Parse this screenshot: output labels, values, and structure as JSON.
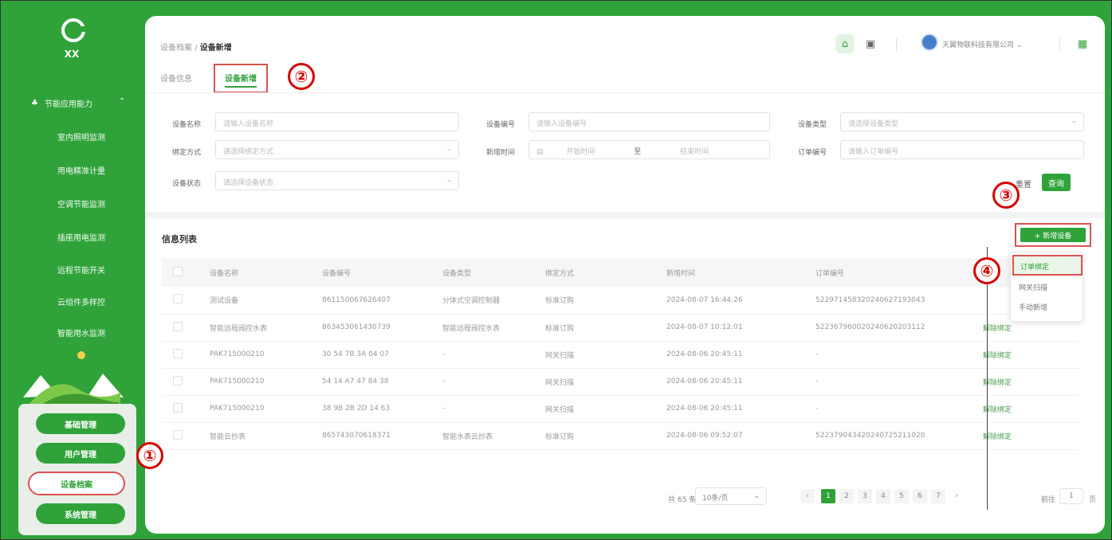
{
  "sidebar": {
    "logo_text": "XX",
    "group_label": "节能应用能力",
    "items": [
      {
        "label": "室内照明监测"
      },
      {
        "label": "用电精准计量"
      },
      {
        "label": "空调节能监测"
      },
      {
        "label": "插座用电监测"
      },
      {
        "label": "远程节能开关"
      },
      {
        "label": "云组件多样控"
      },
      {
        "label": "智能用水监测"
      }
    ],
    "modes": [
      {
        "label": "基础管理"
      },
      {
        "label": "用户管理"
      },
      {
        "label": "设备档案"
      },
      {
        "label": "系统管理"
      }
    ]
  },
  "header": {
    "breadcrumb_parent": "设备档案",
    "breadcrumb_sep": "/",
    "breadcrumb_current": "设备新增",
    "company": "天翼物联科技有限公司 ⌄",
    "home_icon": "home-icon",
    "message_icon": "message-icon",
    "grid_icon": "grid-icon"
  },
  "tabs": [
    {
      "label": "设备信息"
    },
    {
      "label": "设备新增",
      "active": true
    }
  ],
  "filters": {
    "device_name": {
      "label": "设备名称",
      "placeholder": "请输入设备名称"
    },
    "device_no": {
      "label": "设备编号",
      "placeholder": "请输入设备编号"
    },
    "device_type": {
      "label": "设备类型",
      "placeholder": "请选择设备类型"
    },
    "bind_method": {
      "label": "绑定方式",
      "placeholder": "请选择绑定方式"
    },
    "add_time": {
      "label": "新增时间",
      "start": "开始时间",
      "to": "至",
      "end": "结束时间"
    },
    "order_no": {
      "label": "订单编号",
      "placeholder": "请输入订单编号"
    },
    "device_status": {
      "label": "设备状态",
      "placeholder": "请选择设备状态"
    },
    "reset_label": "重置",
    "query_label": "查询"
  },
  "list": {
    "title": "信息列表",
    "add_button": "+ 新增设备",
    "columns": [
      "设备名称",
      "设备编号",
      "设备类型",
      "绑定方式",
      "新增时间",
      "订单编号"
    ],
    "rows": [
      {
        "name": "测试设备",
        "no": "861150067626407",
        "type": "分体式空调控制器",
        "bind": "标准订购",
        "time": "2024-08-07 16:44:26",
        "order": "522971458320240627193043",
        "op": ""
      },
      {
        "name": "智能远程阀控水表",
        "no": "863453061430739",
        "type": "智能远程阀控水表",
        "bind": "标准订购",
        "time": "2024-08-07 10:12:01",
        "order": "522367960020240620203112",
        "op": "解除绑定"
      },
      {
        "name": "PAK715000210",
        "no": "30 54 7B 3A 04 07",
        "type": "-",
        "bind": "网关扫描",
        "time": "2024-08-06 20:45:11",
        "order": "-",
        "op": "解除绑定"
      },
      {
        "name": "PAK715000210",
        "no": "54 14 A7 47 84 38",
        "type": "-",
        "bind": "网关扫描",
        "time": "2024-08-06 20:45:11",
        "order": "-",
        "op": "解除绑定"
      },
      {
        "name": "PAK715000210",
        "no": "38 9B 2B 2D 14 63",
        "type": "-",
        "bind": "网关扫描",
        "time": "2024-08-06 20:45:11",
        "order": "-",
        "op": "解除绑定"
      },
      {
        "name": "智能云抄表",
        "no": "865743070618371",
        "type": "智能水表云抄表",
        "bind": "标准订购",
        "time": "2024-08-06 09:52:07",
        "order": "522379043420240725211020",
        "op": "解除绑定"
      }
    ]
  },
  "menu": {
    "items": [
      "订单绑定",
      "网关扫描",
      "手动新增"
    ]
  },
  "pagination": {
    "total": "共 65 条",
    "page_size": "10条/页",
    "pages": [
      "1",
      "2",
      "3",
      "4",
      "5",
      "6",
      "7"
    ],
    "current": "1",
    "prev": "‹",
    "next": "›",
    "goto_label": "前往",
    "goto_value": "1",
    "goto_unit": "页"
  },
  "callouts": [
    "①",
    "②",
    "③",
    "④"
  ],
  "colors": {
    "brand": "#2fa33a",
    "highlight": "#d9534f",
    "callout": "#d60000"
  }
}
